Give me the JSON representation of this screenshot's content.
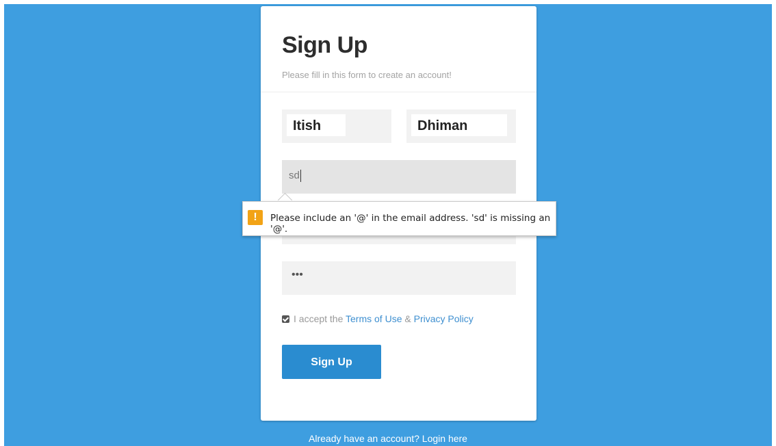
{
  "form": {
    "title": "Sign Up",
    "subtitle": "Please fill in this form to create an account!",
    "first_name_value": "Itish",
    "last_name_value": "Dhiman",
    "email_value": "sd",
    "password_mask": "•••",
    "terms_prefix": "I accept the ",
    "terms_link": "Terms of Use",
    "terms_and": " & ",
    "privacy_link": "Privacy Policy",
    "terms_checked": true,
    "submit_label": "Sign Up"
  },
  "validation": {
    "icon": "warning-icon",
    "icon_glyph": "!",
    "message": "Please include an '@' in the email address. 'sd' is missing an '@'."
  },
  "footer": {
    "text": "Already have an account? Login here"
  },
  "colors": {
    "background": "#3e9ee0",
    "button": "#2a8cd0",
    "link": "#3e8fd0",
    "warning": "#f2a316"
  }
}
